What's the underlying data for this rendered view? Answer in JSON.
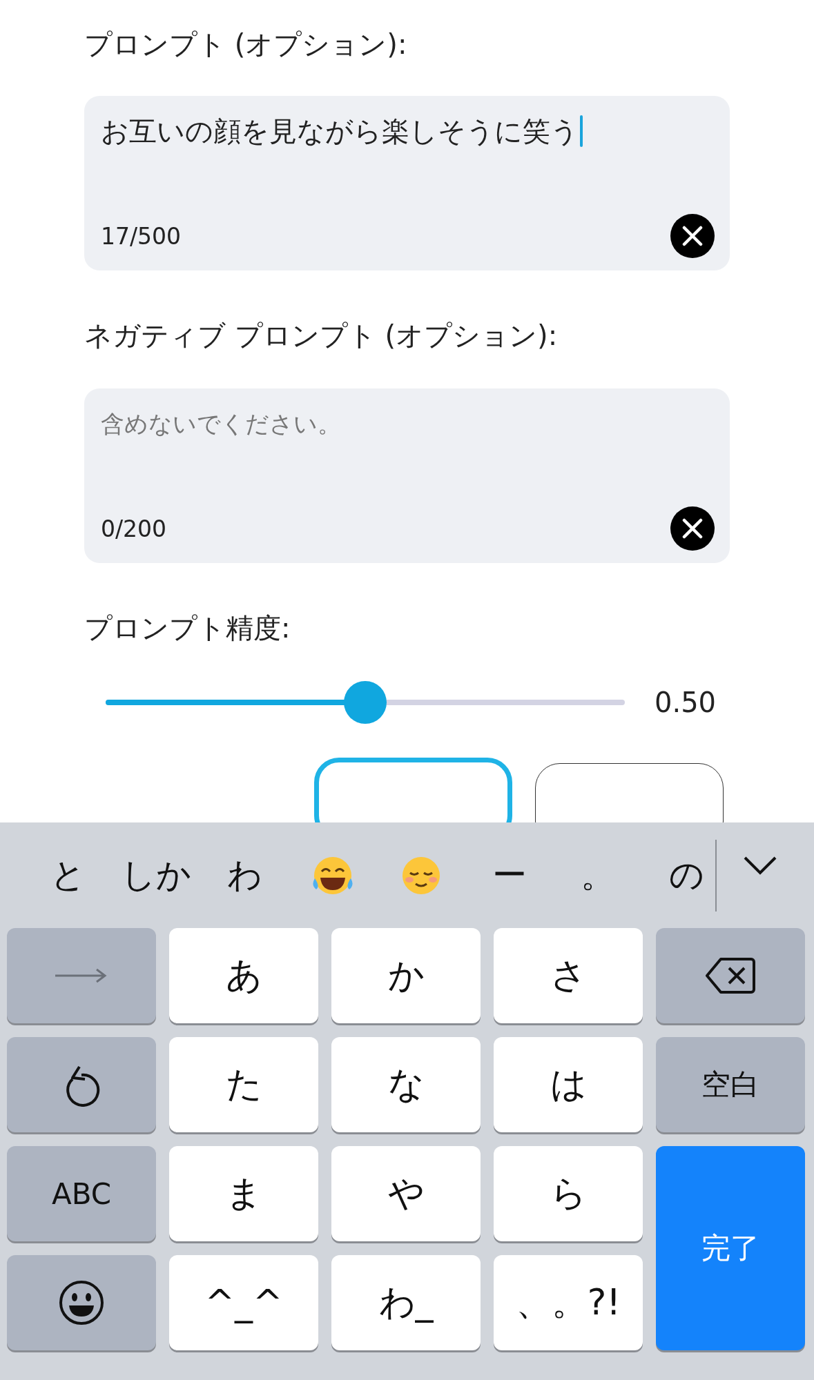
{
  "fields": [
    {
      "label": "プロンプト (オプション):",
      "value": "お互いの顔を見ながら楽しそうに笑う",
      "counter": "17/500",
      "focused": true
    },
    {
      "label": "ネガティブ プロンプト (オプション):",
      "placeholder": "含めないでください。",
      "counter": "0/200",
      "focused": false
    }
  ],
  "slider": {
    "label": "プロンプト精度:",
    "level": 0.5,
    "reading": "0.50"
  },
  "buttons": [
    {
      "kind": "primary"
    },
    {
      "kind": "secondary"
    }
  ],
  "keyboard": {
    "suggestions": [
      {
        "kind": "text",
        "text": "と"
      },
      {
        "kind": "text",
        "text": "しか"
      },
      {
        "kind": "text",
        "text": "わ"
      },
      {
        "kind": "laugh"
      },
      {
        "kind": "smile"
      },
      {
        "kind": "text",
        "text": "ー"
      },
      {
        "kind": "text",
        "text": "。"
      },
      {
        "kind": "text",
        "text": "の"
      }
    ],
    "keys": [
      {
        "kind": "arrow"
      },
      {
        "kind": "char",
        "text": "あ"
      },
      {
        "kind": "char",
        "text": "か"
      },
      {
        "kind": "char",
        "text": "さ"
      },
      {
        "kind": "backspace"
      },
      {
        "kind": "undo"
      },
      {
        "kind": "char",
        "text": "た"
      },
      {
        "kind": "char",
        "text": "な"
      },
      {
        "kind": "char",
        "text": "は"
      },
      {
        "kind": "mode",
        "text": "空白"
      },
      {
        "kind": "mode",
        "text": "ABC"
      },
      {
        "kind": "char",
        "text": "ま"
      },
      {
        "kind": "char",
        "text": "や"
      },
      {
        "kind": "char",
        "text": "ら"
      },
      {
        "kind": "done",
        "text": "完了"
      },
      {
        "kind": "emoji"
      },
      {
        "kind": "char",
        "text": "^_^"
      },
      {
        "kind": "char",
        "text": "わ_"
      },
      {
        "kind": "char",
        "text": "、。?!"
      }
    ]
  }
}
